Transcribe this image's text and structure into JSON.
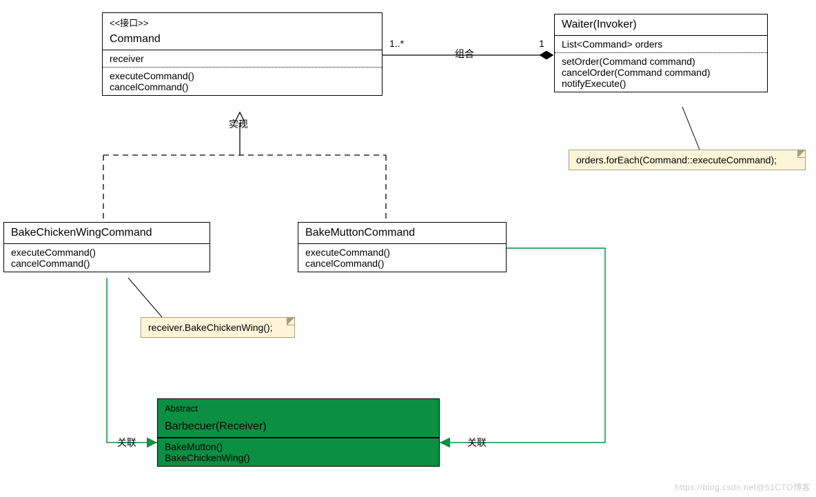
{
  "command": {
    "stereotype": "<<接口>>",
    "name": "Command",
    "attrs": [
      "receiver"
    ],
    "ops": [
      "executeCommand()",
      "cancelCommand()"
    ]
  },
  "waiter": {
    "name": "Waiter(Invoker)",
    "attrs": [
      "List<Command> orders"
    ],
    "ops": [
      "setOrder(Command command)",
      "cancelOrder(Command command)",
      "notifyExecute()"
    ]
  },
  "bakeChicken": {
    "name": "BakeChickenWingCommand",
    "ops": [
      "executeCommand()",
      "cancelCommand()"
    ]
  },
  "bakeMutton": {
    "name": "BakeMuttonCommand",
    "ops": [
      "executeCommand()",
      "cancelCommand()"
    ]
  },
  "barbecuer": {
    "stereotype": "Abstract",
    "name": "Barbecuer(Receiver)",
    "ops": [
      "BakeMutton()",
      "BakeChickenWing()"
    ]
  },
  "labels": {
    "realization": "实现",
    "composition": "组合",
    "assocLeft": "关联",
    "assocRight": "关联",
    "mult_left": "1..*",
    "mult_right": "1"
  },
  "notes": {
    "forEach": "orders.forEach(Command::executeCommand);",
    "receiverCall": "receiver.BakeChickenWing();"
  },
  "watermark": "https://blog.csdn.net@51CTO博客"
}
